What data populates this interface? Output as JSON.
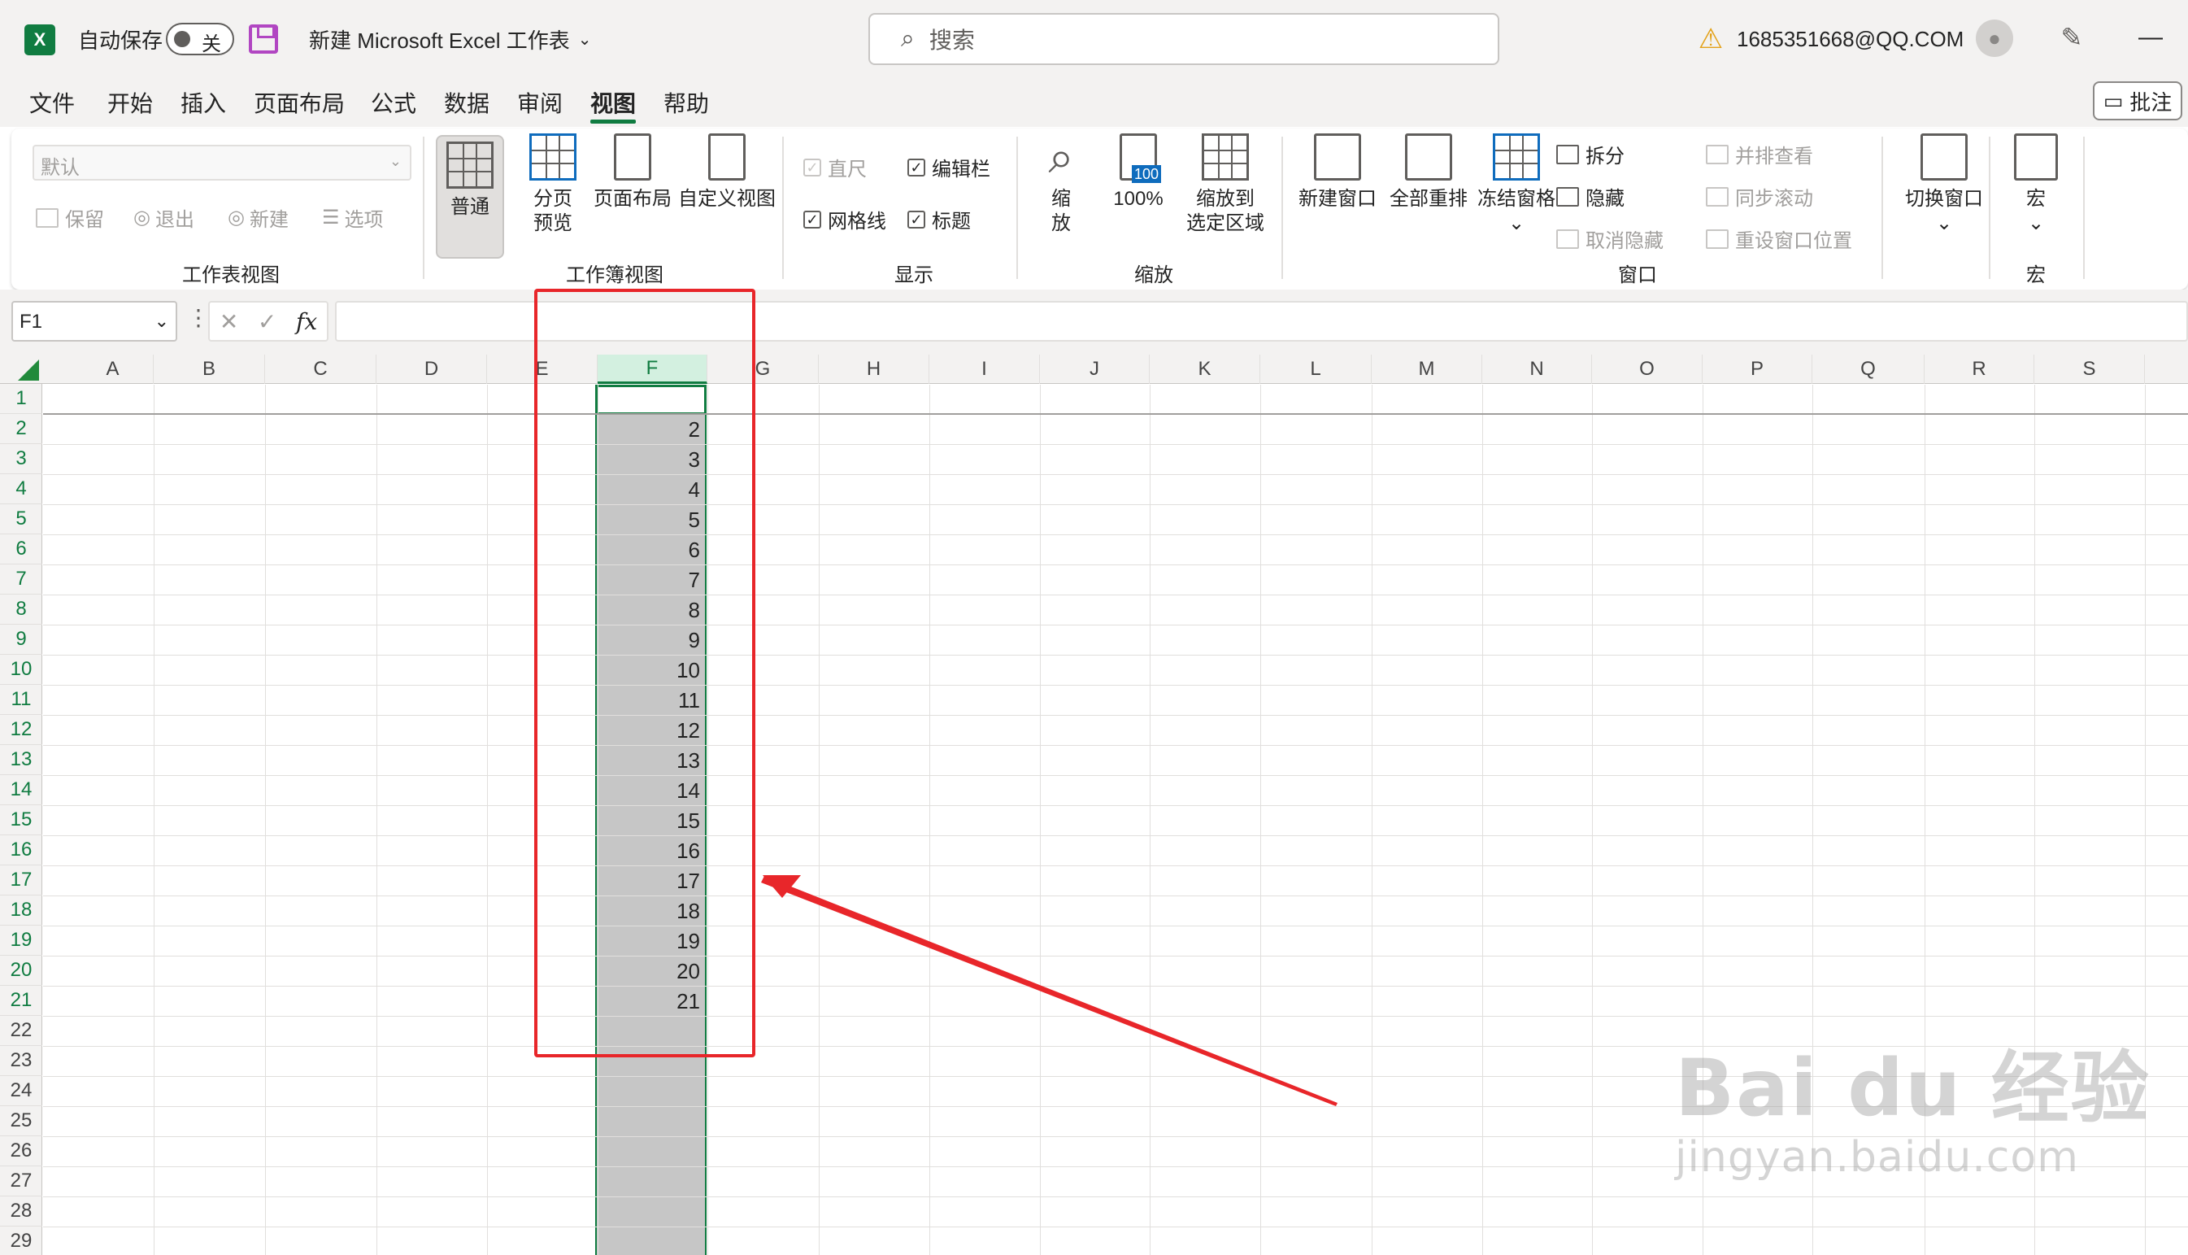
{
  "titlebar": {
    "autosave_label": "自动保存",
    "autosave_state": "关",
    "doc_title": "新建 Microsoft Excel 工作表",
    "search_placeholder": "搜索",
    "user_email": "1685351668@QQ.COM",
    "minimize": "—"
  },
  "menu": {
    "tabs": [
      {
        "label": "文件",
        "active": false
      },
      {
        "label": "开始",
        "active": false
      },
      {
        "label": "插入",
        "active": false
      },
      {
        "label": "页面布局",
        "active": false
      },
      {
        "label": "公式",
        "active": false
      },
      {
        "label": "数据",
        "active": false
      },
      {
        "label": "审阅",
        "active": false
      },
      {
        "label": "视图",
        "active": true
      },
      {
        "label": "帮助",
        "active": false
      }
    ],
    "comments_label": "批注"
  },
  "ribbon": {
    "sheet_view": {
      "select_value": "默认",
      "keep": "保留",
      "exit": "退出",
      "new": "新建",
      "options": "选项",
      "group_label": "工作表视图"
    },
    "workbook_views": {
      "normal": "普通",
      "page_break_1": "分页",
      "page_break_2": "预览",
      "page_layout": "页面布局",
      "custom_views": "自定义视图",
      "group_label": "工作簿视图"
    },
    "show": {
      "ruler": "直尺",
      "formula_bar": "编辑栏",
      "gridlines": "网格线",
      "headings": "标题",
      "group_label": "显示"
    },
    "zoom": {
      "zoom_1": "缩",
      "zoom_2": "放",
      "hundred": "100%",
      "hundred_icon": "100",
      "zoom_sel_1": "缩放到",
      "zoom_sel_2": "选定区域",
      "group_label": "缩放"
    },
    "window": {
      "new_window": "新建窗口",
      "arrange_all": "全部重排",
      "freeze_panes": "冻结窗格",
      "split": "拆分",
      "hide": "隐藏",
      "unhide": "取消隐藏",
      "side_by_side": "并排查看",
      "sync_scroll": "同步滚动",
      "reset_position": "重设窗口位置",
      "switch_windows": "切换窗口",
      "group_label": "窗口"
    },
    "macros": {
      "macro": "宏",
      "group_label": "宏"
    }
  },
  "formula_bar": {
    "name_box": "F1",
    "formula": ""
  },
  "sheet": {
    "columns": [
      "A",
      "B",
      "C",
      "D",
      "E",
      "F",
      "G",
      "H",
      "I",
      "J",
      "K",
      "L",
      "M",
      "N",
      "O",
      "P",
      "Q",
      "R",
      "S"
    ],
    "selected_column": "F",
    "rows": [
      "1",
      "2",
      "3",
      "4",
      "5",
      "6",
      "7",
      "8",
      "9",
      "10",
      "11",
      "12",
      "13",
      "14",
      "15",
      "16",
      "17",
      "18",
      "19",
      "20",
      "21",
      "22",
      "23",
      "24",
      "25",
      "26",
      "27",
      "28",
      "29"
    ],
    "f_values": [
      "",
      "2",
      "3",
      "4",
      "5",
      "6",
      "7",
      "8",
      "9",
      "10",
      "11",
      "12",
      "13",
      "14",
      "15",
      "16",
      "17",
      "18",
      "19",
      "20",
      "21"
    ]
  },
  "watermark": {
    "line1": "Bai du 经验",
    "line2": "jingyan.baidu.com"
  },
  "colors": {
    "excel_green": "#107c41",
    "annotation_red": "#e8262a",
    "selection_gray": "#c6c6c6"
  }
}
